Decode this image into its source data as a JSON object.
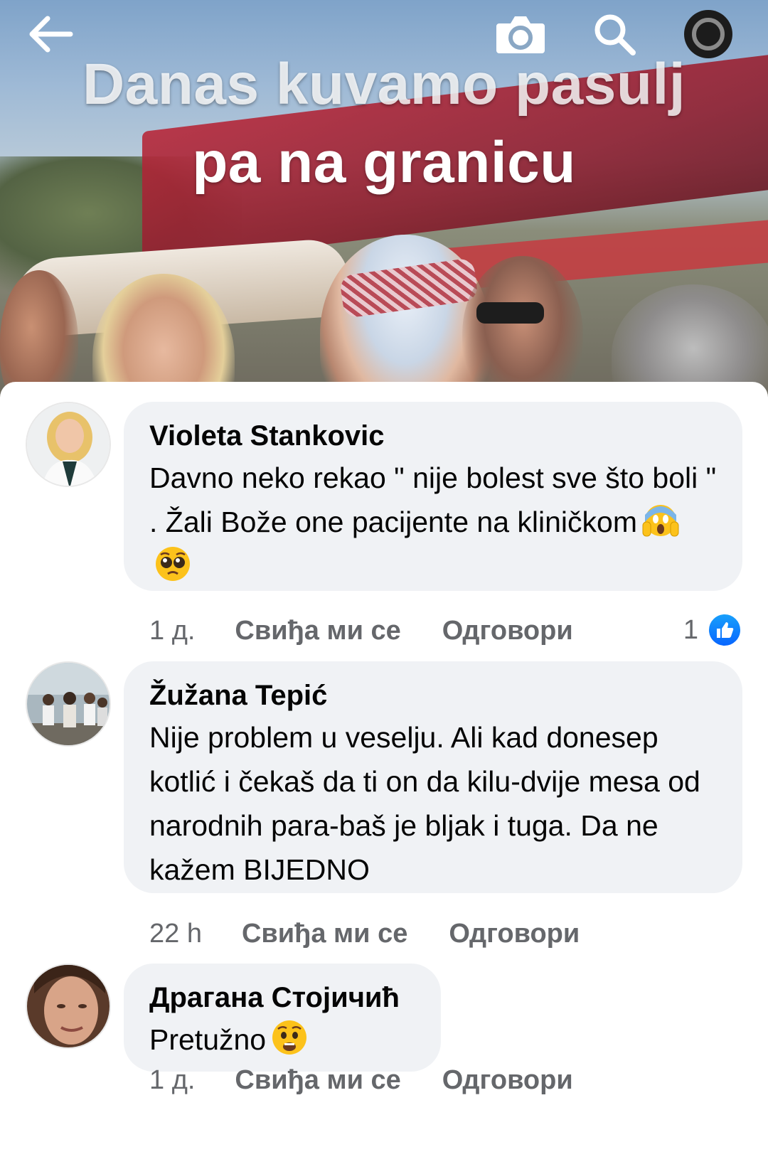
{
  "video": {
    "caption_line1": "Danas kuvamo pasulj",
    "caption_line2": "pa na granicu"
  },
  "topbar": {
    "icons": [
      "back-arrow-icon",
      "camera-icon",
      "search-icon",
      "record-icon"
    ]
  },
  "comments": [
    {
      "author": "Violeta Stankovic",
      "text": "Davno neko rekao \" nije bolest sve što boli \" . Žali Bože one pacijente na kliničkom",
      "emojis": [
        "screaming-face-emoji",
        "pleading-face-emoji"
      ],
      "time": "1 д.",
      "like_label": "Свиђа ми се",
      "reply_label": "Одговори",
      "reaction_count": "1"
    },
    {
      "author": "Žužana Tepić",
      "text": "Nije problem u veselju. Ali kad donesep kotlić i čekaš da ti on da kilu-dvije mesa od narodnih para-baš je bljak i tuga. Da ne kažem BIJEDNO",
      "time": "22 h",
      "like_label": "Свиђа ми се",
      "reply_label": "Одговори"
    },
    {
      "author": "Драгана Стојичић",
      "text": "Pretužno",
      "emojis": [
        "worried-face-emoji"
      ],
      "time": "1 д.",
      "like_label": "Свиђа ми се",
      "reply_label": "Одговори"
    }
  ],
  "colors": {
    "bubble": "#f0f2f5",
    "meta": "#65676b",
    "like_blue": "#0866ff"
  }
}
